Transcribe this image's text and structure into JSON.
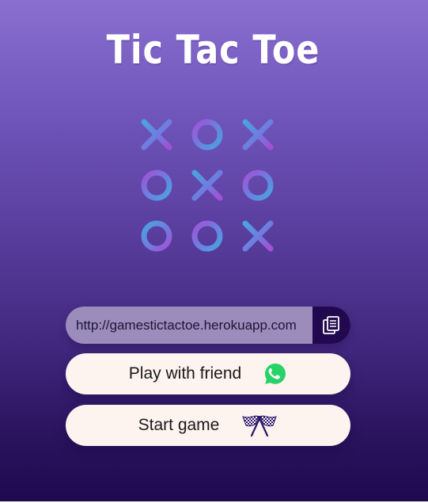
{
  "app": {
    "title": "Tic Tac Toe"
  },
  "share": {
    "url": "http://gamestictactoe.herokuapp.com",
    "copy_icon": "copy-icon"
  },
  "buttons": {
    "play_with_friend": {
      "label": "Play with friend",
      "icon": "whatsapp-icon"
    },
    "start_game": {
      "label": "Start game",
      "icon": "checkered-flags-icon"
    }
  },
  "logo": {
    "icon": "tic-tac-toe-board-icon",
    "board": [
      [
        "X",
        "O",
        "X"
      ],
      [
        "O",
        "X",
        "O"
      ],
      [
        "O",
        "O",
        "X"
      ]
    ]
  },
  "colors": {
    "background_top": "#8a6fd0",
    "background_bottom": "#1e0a4f",
    "copy_button": "#21084f",
    "button_bg": "#fdf3ef",
    "logo_blue": "#4aa3df",
    "logo_purple": "#a44fd6",
    "whatsapp_green": "#25d366"
  }
}
